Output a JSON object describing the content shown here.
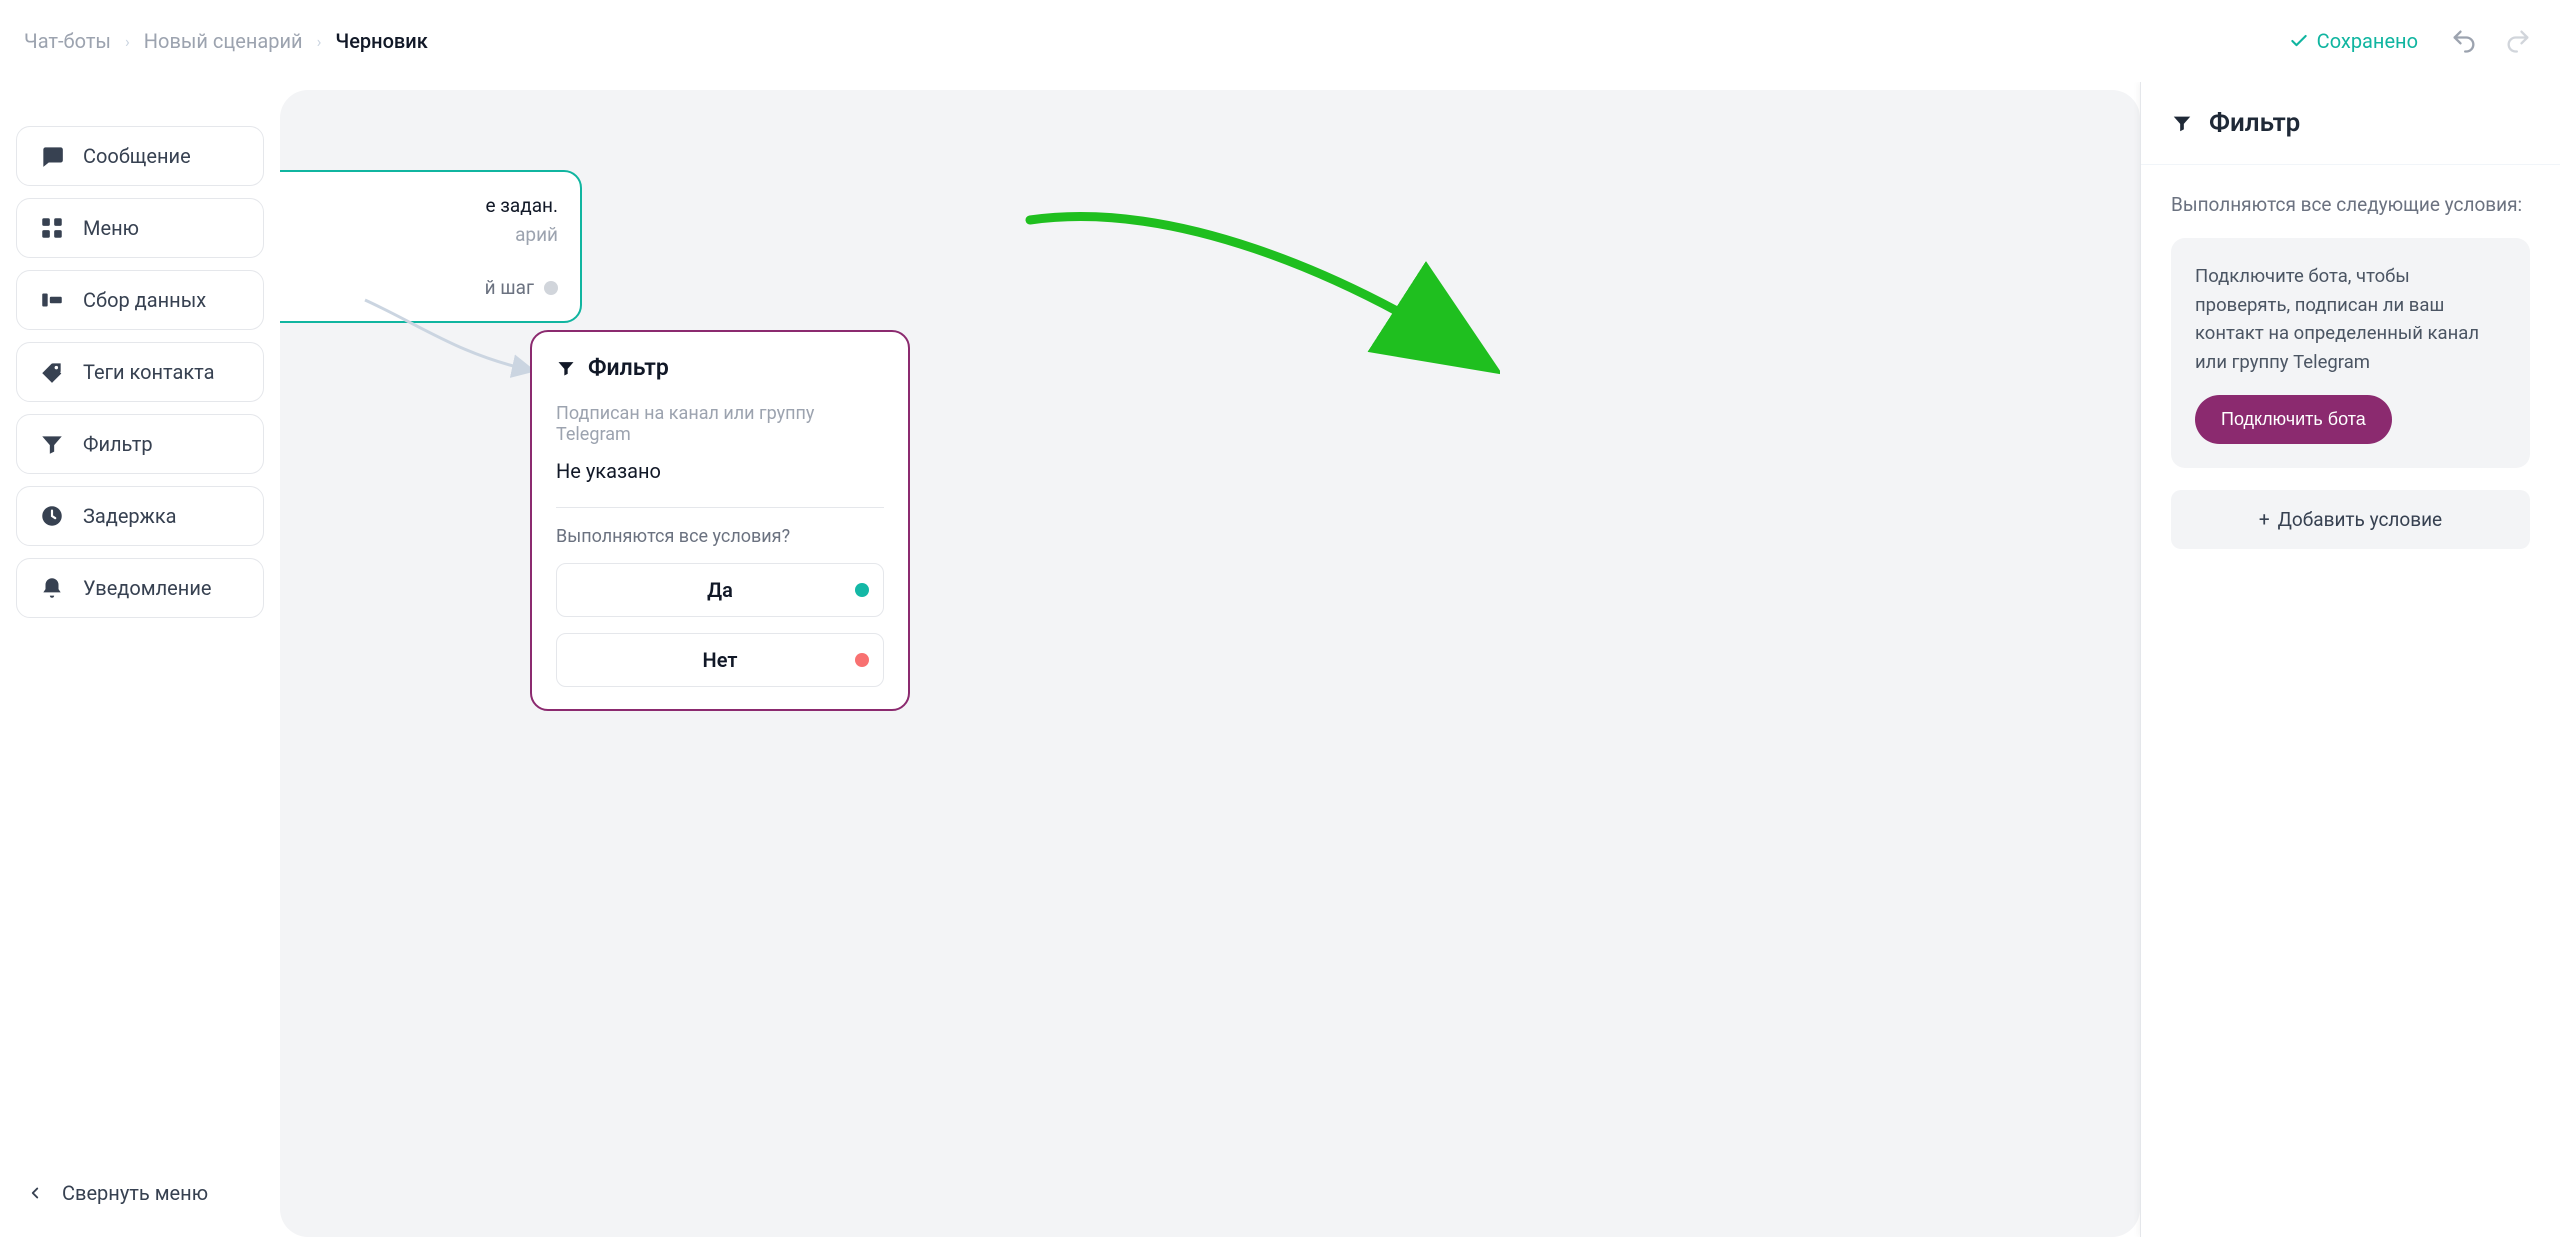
{
  "breadcrumb": {
    "root": "Чат-боты",
    "mid": "Новый сценарий",
    "current": "Черновик"
  },
  "top": {
    "saved": "Сохранено"
  },
  "sidebar": {
    "items": [
      {
        "label": "Сообщение"
      },
      {
        "label": "Меню"
      },
      {
        "label": "Сбор данных"
      },
      {
        "label": "Теги контакта"
      },
      {
        "label": "Фильтр"
      },
      {
        "label": "Задержка"
      },
      {
        "label": "Уведомление"
      }
    ],
    "collapse": "Свернуть меню"
  },
  "canvas": {
    "trigger": {
      "line1": "е задан.",
      "line2": "арий",
      "line3": "й шаг"
    },
    "filter_node": {
      "title": "Фильтр",
      "sub": "Подписан на канал или группу Telegram",
      "value": "Не указано",
      "question": "Выполняются все условия?",
      "yes": "Да",
      "no": "Нет"
    }
  },
  "panel": {
    "title": "Фильтр",
    "intro": "Выполняются все следующие условия:",
    "info": "Подключите бота, чтобы проверять, подписан ли ваш контакт на определенный канал или группу Telegram",
    "connect": "Подключить бота",
    "add": "Добавить условие"
  },
  "colors": {
    "teal": "#10b5a0",
    "purple": "#8b2a6f",
    "green_arrow": "#1fbf1f"
  }
}
